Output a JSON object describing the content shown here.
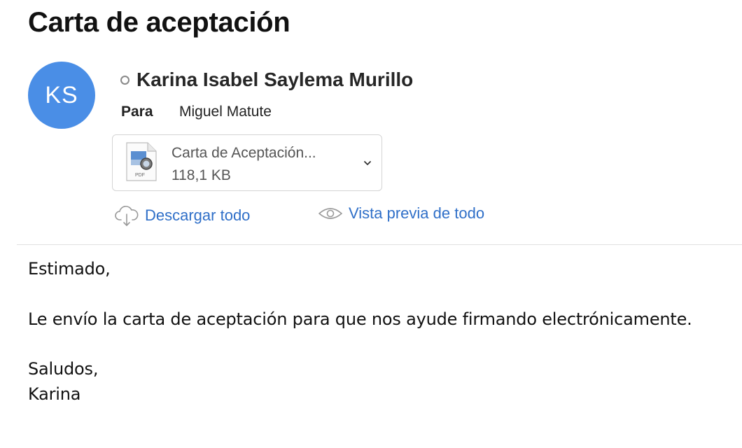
{
  "email": {
    "subject": "Carta de aceptación",
    "sender": {
      "initials": "KS",
      "name": "Karina Isabel Saylema Murillo",
      "avatar_color": "#4a8ee6"
    },
    "recipient": {
      "label": "Para",
      "name": "Miguel Matute"
    },
    "attachment": {
      "name": "Carta de Aceptación...",
      "size": "118,1 KB",
      "icon": "pdf-file-icon",
      "type_label": "PDF"
    },
    "actions": {
      "download_all": "Descargar todo",
      "preview_all": "Vista previa de todo"
    },
    "body": {
      "greeting": "Estimado,",
      "message": "Le envío la carta de aceptación para que nos ayude firmando electrónicamente.",
      "closing": "Saludos,",
      "signature": "Karina"
    }
  },
  "colors": {
    "link": "#2f6fc8",
    "avatar": "#4a8ee6"
  }
}
